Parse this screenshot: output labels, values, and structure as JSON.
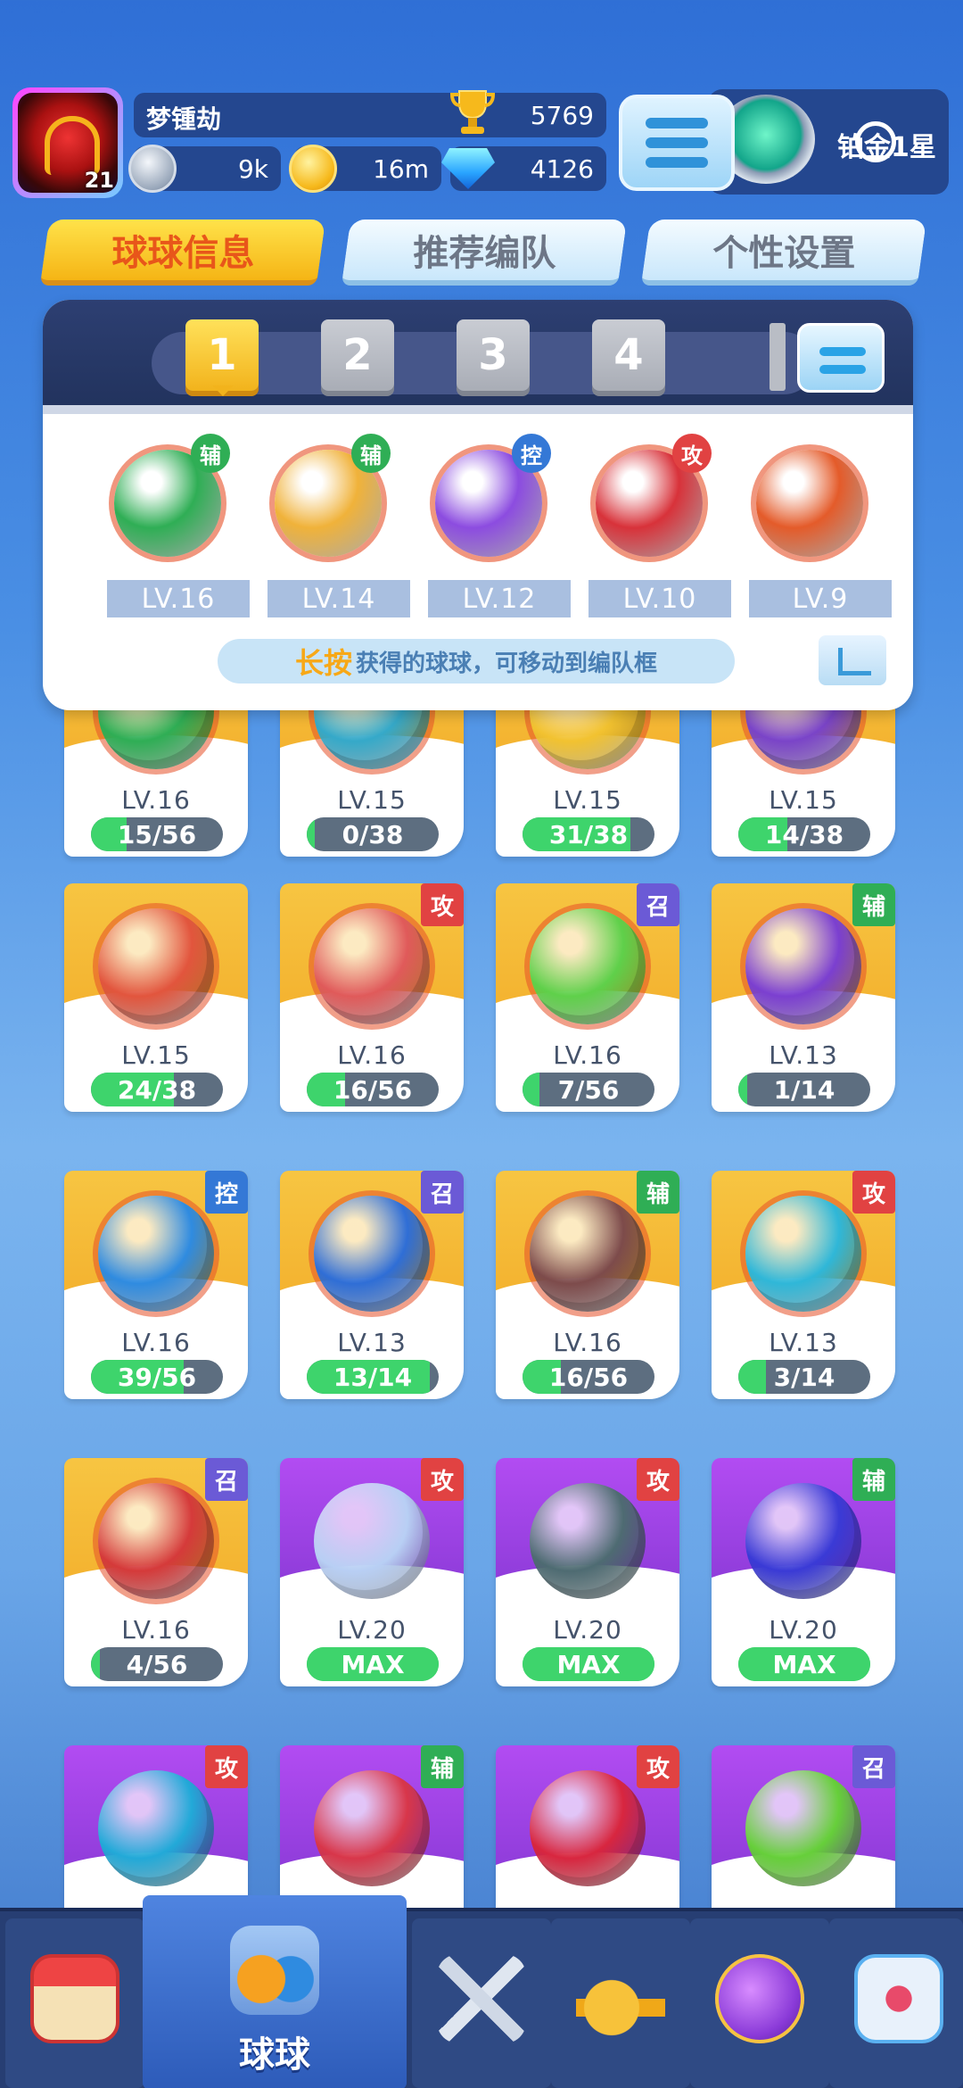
{
  "player": {
    "name": "梦锺劫",
    "level": "21",
    "trophies": "5769",
    "silver": "9k",
    "gold": "16m",
    "gems": "4126",
    "rank": "铂金1星"
  },
  "tabs": [
    {
      "label": "球球信息",
      "active": true
    },
    {
      "label": "推荐编队",
      "active": false
    },
    {
      "label": "个性设置",
      "active": false
    }
  ],
  "team": {
    "slots": [
      "1",
      "2",
      "3",
      "4"
    ],
    "active_slot": "1",
    "balls": [
      {
        "tag": "辅",
        "level": "LV.16",
        "color": "#2fae55"
      },
      {
        "tag": "辅",
        "level": "LV.14",
        "color": "#2fae55"
      },
      {
        "tag": "控",
        "level": "LV.12",
        "color": "#3478d6"
      },
      {
        "tag": "攻",
        "level": "LV.10",
        "color": "#e14242"
      },
      {
        "tag": "",
        "level": "LV.9",
        "color": ""
      }
    ],
    "hint_highlight": "长按",
    "hint_text": "获得的球球，可移动到编队框"
  },
  "cards": [
    {
      "level": "LV.16",
      "progress": "15/56",
      "fill": 0.27,
      "tag": "",
      "theme": "yellow",
      "orb": "#2fae55"
    },
    {
      "level": "LV.15",
      "progress": "0/38",
      "fill": 0.0,
      "tag": "",
      "theme": "yellow",
      "orb": "#35a9c9"
    },
    {
      "level": "LV.15",
      "progress": "31/38",
      "fill": 0.82,
      "tag": "",
      "theme": "yellow",
      "orb": "#f2c230"
    },
    {
      "level": "LV.15",
      "progress": "14/38",
      "fill": 0.37,
      "tag": "",
      "theme": "yellow",
      "orb": "#7a44c8"
    },
    {
      "level": "LV.15",
      "progress": "24/38",
      "fill": 0.63,
      "tag": "",
      "theme": "yellow",
      "orb": "#e2553d"
    },
    {
      "level": "LV.16",
      "progress": "16/56",
      "fill": 0.29,
      "tag": "攻",
      "theme": "yellow",
      "orb": "#e05a5a"
    },
    {
      "level": "LV.16",
      "progress": "7/56",
      "fill": 0.13,
      "tag": "召",
      "theme": "yellow",
      "orb": "#5fd04a"
    },
    {
      "level": "LV.13",
      "progress": "1/14",
      "fill": 0.07,
      "tag": "辅",
      "theme": "yellow",
      "orb": "#7b3fd0"
    },
    {
      "level": "LV.16",
      "progress": "39/56",
      "fill": 0.7,
      "tag": "控",
      "theme": "yellow",
      "orb": "#2f8be0"
    },
    {
      "level": "LV.13",
      "progress": "13/14",
      "fill": 0.93,
      "tag": "召",
      "theme": "yellow",
      "orb": "#2f6ed6"
    },
    {
      "level": "LV.16",
      "progress": "16/56",
      "fill": 0.29,
      "tag": "辅",
      "theme": "yellow",
      "orb": "#7d4b4b"
    },
    {
      "level": "LV.13",
      "progress": "3/14",
      "fill": 0.21,
      "tag": "攻",
      "theme": "yellow",
      "orb": "#2fb7d8"
    },
    {
      "level": "LV.16",
      "progress": "4/56",
      "fill": 0.07,
      "tag": "召",
      "theme": "yellow",
      "orb": "#d53a3a"
    },
    {
      "level": "LV.20",
      "progress": "MAX",
      "fill": 1,
      "tag": "攻",
      "theme": "purple",
      "orb": "#b8cff4"
    },
    {
      "level": "LV.20",
      "progress": "MAX",
      "fill": 1,
      "tag": "攻",
      "theme": "purple",
      "orb": "#4e6b72"
    },
    {
      "level": "LV.20",
      "progress": "MAX",
      "fill": 1,
      "tag": "辅",
      "theme": "purple",
      "orb": "#3a3ad6"
    },
    {
      "level": "",
      "progress": "",
      "fill": 0,
      "tag": "攻",
      "theme": "purple",
      "orb": "#22a9d8"
    },
    {
      "level": "",
      "progress": "",
      "fill": 0,
      "tag": "辅",
      "theme": "purple",
      "orb": "#d8364a"
    },
    {
      "level": "",
      "progress": "",
      "fill": 0,
      "tag": "攻",
      "theme": "purple",
      "orb": "#d8263f"
    },
    {
      "level": "",
      "progress": "",
      "fill": 0,
      "tag": "召",
      "theme": "purple",
      "orb": "#66cf3a"
    }
  ],
  "nav": {
    "items": [
      {
        "icon": "shop-icon"
      },
      {
        "icon": "ball-jar-icon",
        "label": "球球"
      },
      {
        "icon": "crossed-swords-icon"
      },
      {
        "icon": "whistle-icon"
      },
      {
        "icon": "planet-icon"
      },
      {
        "icon": "chat-heart-icon"
      }
    ]
  },
  "colors": {
    "tab_active": "#f5b515",
    "progress_fill": "#3ed46c",
    "tag_attack": "#e14242",
    "tag_support": "#2fae55",
    "tag_control": "#3478d6",
    "tag_summon": "#6b5ad6"
  }
}
